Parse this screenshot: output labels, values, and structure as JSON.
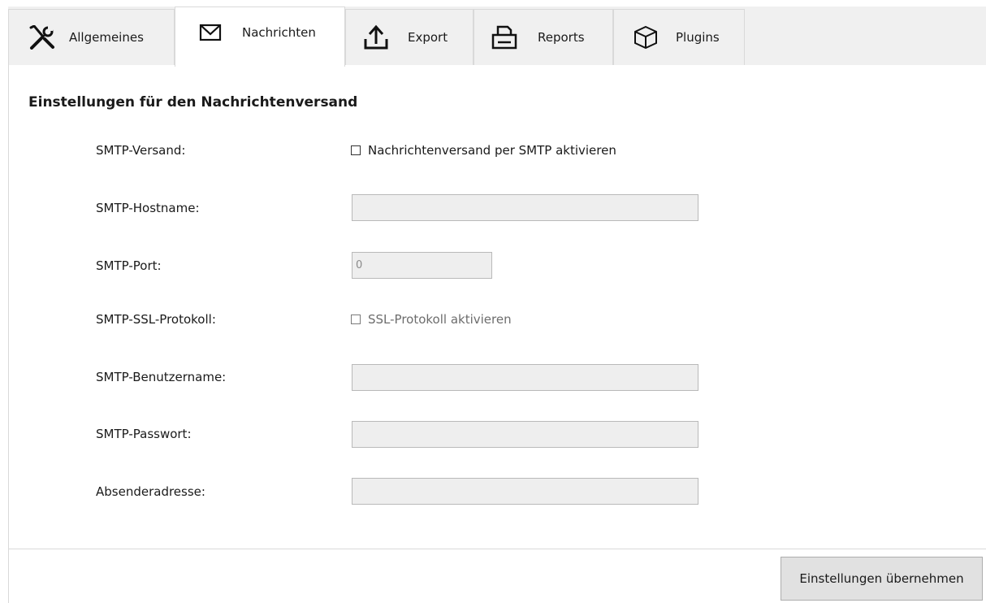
{
  "tabs": [
    {
      "label": "Allgemeines",
      "icon": "tools-icon",
      "active": false
    },
    {
      "label": "Nachrichten",
      "icon": "envelope-icon",
      "active": true
    },
    {
      "label": "Export",
      "icon": "upload-icon",
      "active": false
    },
    {
      "label": "Reports",
      "icon": "printer-icon",
      "active": false
    },
    {
      "label": "Plugins",
      "icon": "cube-icon",
      "active": false
    }
  ],
  "section": {
    "title": "Einstellungen für den Nachrichtenversand"
  },
  "form": {
    "smtp_send": {
      "label": "SMTP-Versand:",
      "checkbox_label": "Nachrichtenversand per SMTP aktivieren",
      "checked": false
    },
    "smtp_host": {
      "label": "SMTP-Hostname:",
      "value": ""
    },
    "smtp_port": {
      "label": "SMTP-Port:",
      "value": "0"
    },
    "smtp_ssl": {
      "label": "SMTP-SSL-Protokoll:",
      "checkbox_label": "SSL-Protokoll aktivieren",
      "checked": false,
      "disabled": true
    },
    "smtp_user": {
      "label": "SMTP-Benutzername:",
      "value": ""
    },
    "smtp_password": {
      "label": "SMTP-Passwort:",
      "value": ""
    },
    "sender_address": {
      "label": "Absenderadresse:",
      "value": ""
    }
  },
  "footer": {
    "apply_label": "Einstellungen übernehmen"
  },
  "colors": {
    "tab_bg": "#f0f0f0",
    "active_tab_bg": "#ffffff",
    "border": "#d9d9d9",
    "input_bg": "#eeeeee",
    "button_bg": "#e1e1e1"
  }
}
